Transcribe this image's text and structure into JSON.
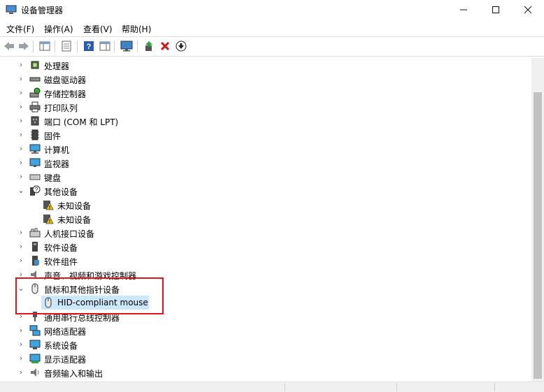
{
  "window": {
    "title": "设备管理器"
  },
  "menu": [
    "文件(F)",
    "操作(A)",
    "查看(V)",
    "帮助(H)"
  ],
  "tree": [
    {
      "label": "处理器",
      "icon": "cpu-icon",
      "expanded": false
    },
    {
      "label": "磁盘驱动器",
      "icon": "disk-icon",
      "expanded": false
    },
    {
      "label": "存储控制器",
      "icon": "storage-icon",
      "expanded": false
    },
    {
      "label": "打印队列",
      "icon": "printer-icon",
      "expanded": false
    },
    {
      "label": "端口 (COM 和 LPT)",
      "icon": "port-icon",
      "expanded": false
    },
    {
      "label": "固件",
      "icon": "firmware-icon",
      "expanded": false
    },
    {
      "label": "计算机",
      "icon": "computer-icon",
      "expanded": false
    },
    {
      "label": "监视器",
      "icon": "monitor-icon",
      "expanded": false
    },
    {
      "label": "键盘",
      "icon": "keyboard-icon",
      "expanded": false
    },
    {
      "label": "其他设备",
      "icon": "other-devices-icon",
      "expanded": true
    },
    {
      "label": "未知设备",
      "icon": "unknown-device-warning-icon",
      "child": true
    },
    {
      "label": "未知设备",
      "icon": "unknown-device-warning-icon",
      "child": true
    },
    {
      "label": "人机接口设备",
      "icon": "hid-icon",
      "expanded": false
    },
    {
      "label": "软件设备",
      "icon": "software-device-icon",
      "expanded": false
    },
    {
      "label": "软件组件",
      "icon": "software-component-icon",
      "expanded": false
    },
    {
      "label": "声音、视频和游戏控制器",
      "icon": "audio-icon",
      "expanded": false
    },
    {
      "label": "鼠标和其他指针设备",
      "icon": "mouse-icon",
      "expanded": true
    },
    {
      "label": "HID-compliant mouse",
      "icon": "mouse-icon",
      "child": true,
      "selected": true
    },
    {
      "label": "通用串行总线控制器",
      "icon": "usb-icon",
      "expanded": false
    },
    {
      "label": "网络适配器",
      "icon": "network-icon",
      "expanded": false
    },
    {
      "label": "系统设备",
      "icon": "system-device-icon",
      "expanded": false
    },
    {
      "label": "显示适配器",
      "icon": "display-adapter-icon",
      "expanded": false
    },
    {
      "label": "音频输入和输出",
      "icon": "audio-io-icon",
      "expanded": false
    }
  ],
  "colors": {
    "highlight_box": "#e0161b",
    "selection": "#cce8ff"
  }
}
